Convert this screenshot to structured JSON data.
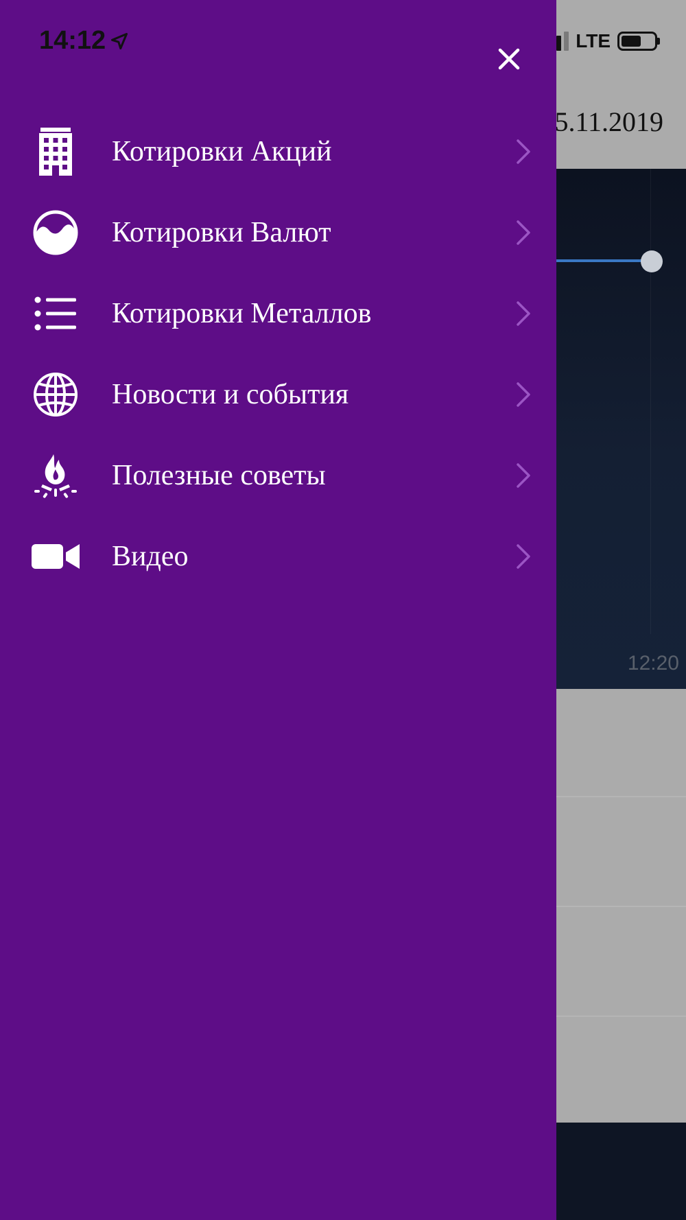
{
  "status_bar": {
    "time": "14:12",
    "network": "LTE"
  },
  "background": {
    "date": "5.11.2019",
    "chart_time_label": "12:20"
  },
  "drawer": {
    "close_icon": "close-icon",
    "menu": [
      {
        "label": "Котировки Акций",
        "icon": "building-icon"
      },
      {
        "label": "Котировки Валют",
        "icon": "wave-circle-icon"
      },
      {
        "label": "Котировки Металлов",
        "icon": "list-icon"
      },
      {
        "label": "Новости и события",
        "icon": "globe-icon"
      },
      {
        "label": "Полезные советы",
        "icon": "campfire-icon"
      },
      {
        "label": "Видео",
        "icon": "video-camera-icon"
      }
    ]
  },
  "colors": {
    "drawer_background": "#5e0d87",
    "menu_text": "#ffffff",
    "chevron": "#9b55c4",
    "overlay": "#ababab",
    "chart_background": "#0c1220"
  }
}
